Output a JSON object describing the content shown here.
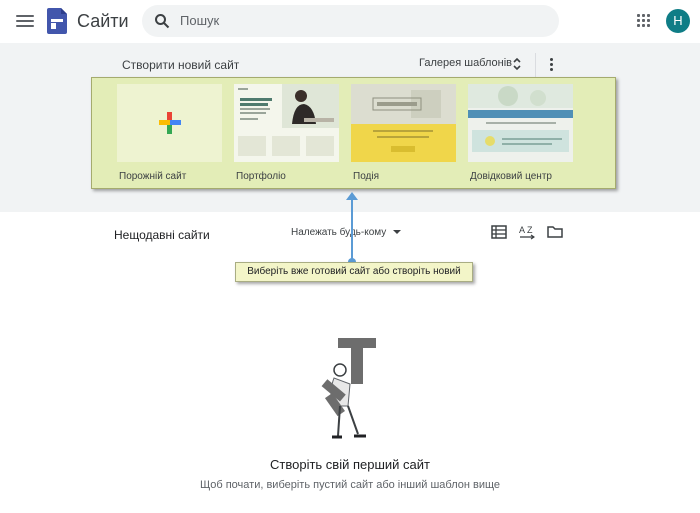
{
  "header": {
    "app_title": "Сайти",
    "search_placeholder": "Пошук",
    "avatar_initial": "H",
    "colors": {
      "logo": "#4256ac",
      "avatar": "#0f7d86",
      "search_bg": "#f1f3f4"
    }
  },
  "templates": {
    "section_title": "Створити новий сайт",
    "gallery_label": "Галерея шаблонів",
    "items": [
      {
        "label": "Порожній сайт",
        "thumb": "plus-icon"
      },
      {
        "label": "Портфоліо",
        "thumb": "portfolio-preview"
      },
      {
        "label": "Подія",
        "thumb": "event-preview"
      },
      {
        "label": "Довідковий центр",
        "thumb": "help-center-preview"
      }
    ],
    "highlight_color": "#deeaa0"
  },
  "recent": {
    "title": "Нещодавні сайти",
    "owner_filter": "Належать будь-кому",
    "tools": [
      "list-view-icon",
      "sort-az-icon",
      "folder-icon"
    ]
  },
  "callout": {
    "text": "Виберіть вже готовий сайт або створіть новий",
    "arrow_color": "#5b9bd5"
  },
  "empty_state": {
    "title": "Створіть свій перший сайт",
    "subtitle": "Щоб почати, виберіть пустий сайт або інший шаблон вище"
  }
}
